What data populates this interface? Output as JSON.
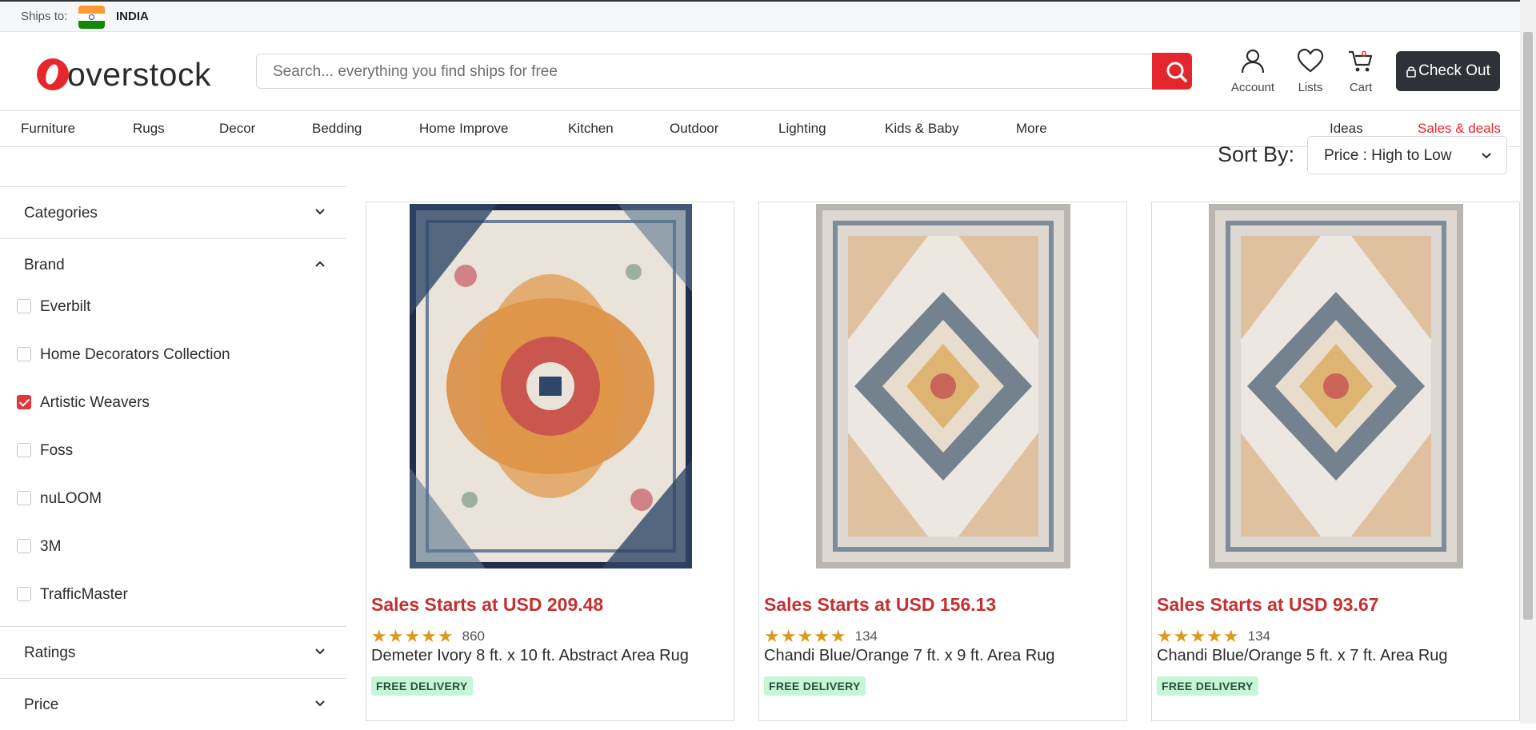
{
  "shipbar": {
    "label": "Ships to:",
    "country": "INDIA"
  },
  "header": {
    "logo_text": "overstock",
    "search_placeholder": "Search... everything you find ships for free",
    "account_label": "Account",
    "lists_label": "Lists",
    "cart_label": "Cart",
    "cart_count": "0",
    "checkout_label": "Check Out"
  },
  "nav": {
    "items": [
      "Furniture",
      "Rugs",
      "Decor",
      "Bedding",
      "Home Improve",
      "Kitchen",
      "Outdoor",
      "Lighting",
      "Kids & Baby",
      "More"
    ],
    "ideas": "Ideas",
    "sales": "Sales & deals",
    "sales_color": "#e3262d"
  },
  "sort": {
    "label": "Sort By:",
    "value": "Price : High to Low"
  },
  "filters": {
    "categories": "Categories",
    "brand": "Brand",
    "brands": [
      {
        "name": "Everbilt",
        "checked": false
      },
      {
        "name": "Home Decorators Collection",
        "checked": false
      },
      {
        "name": "Artistic Weavers",
        "checked": true
      },
      {
        "name": "Foss",
        "checked": false
      },
      {
        "name": "nuLOOM",
        "checked": false
      },
      {
        "name": "3M",
        "checked": false
      },
      {
        "name": "TrafficMaster",
        "checked": false
      }
    ],
    "ratings": "Ratings",
    "price": "Price"
  },
  "products": [
    {
      "price": "Sales Starts at USD 209.48",
      "rating": 5,
      "stars": "★★★★★",
      "reviews": "860",
      "name": "Demeter Ivory 8 ft. x 10 ft. Abstract Area Rug",
      "badge": "FREE DELIVERY"
    },
    {
      "price": "Sales Starts at USD 156.13",
      "rating": 5,
      "stars": "★★★★★",
      "reviews": "134",
      "name": "Chandi Blue/Orange 7 ft. x 9 ft. Area Rug",
      "badge": "FREE DELIVERY"
    },
    {
      "price": "Sales Starts at USD 93.67",
      "rating": 5,
      "stars": "★★★★★",
      "reviews": "134",
      "name": "Chandi Blue/Orange 5 ft. x 7 ft. Area Rug",
      "badge": "FREE DELIVERY"
    }
  ],
  "colors": {
    "accent": "#e3262d",
    "price": "#c53030",
    "star": "#d89b22",
    "badge_bg": "#c6f6d5",
    "checkout_bg": "#2e3136"
  }
}
